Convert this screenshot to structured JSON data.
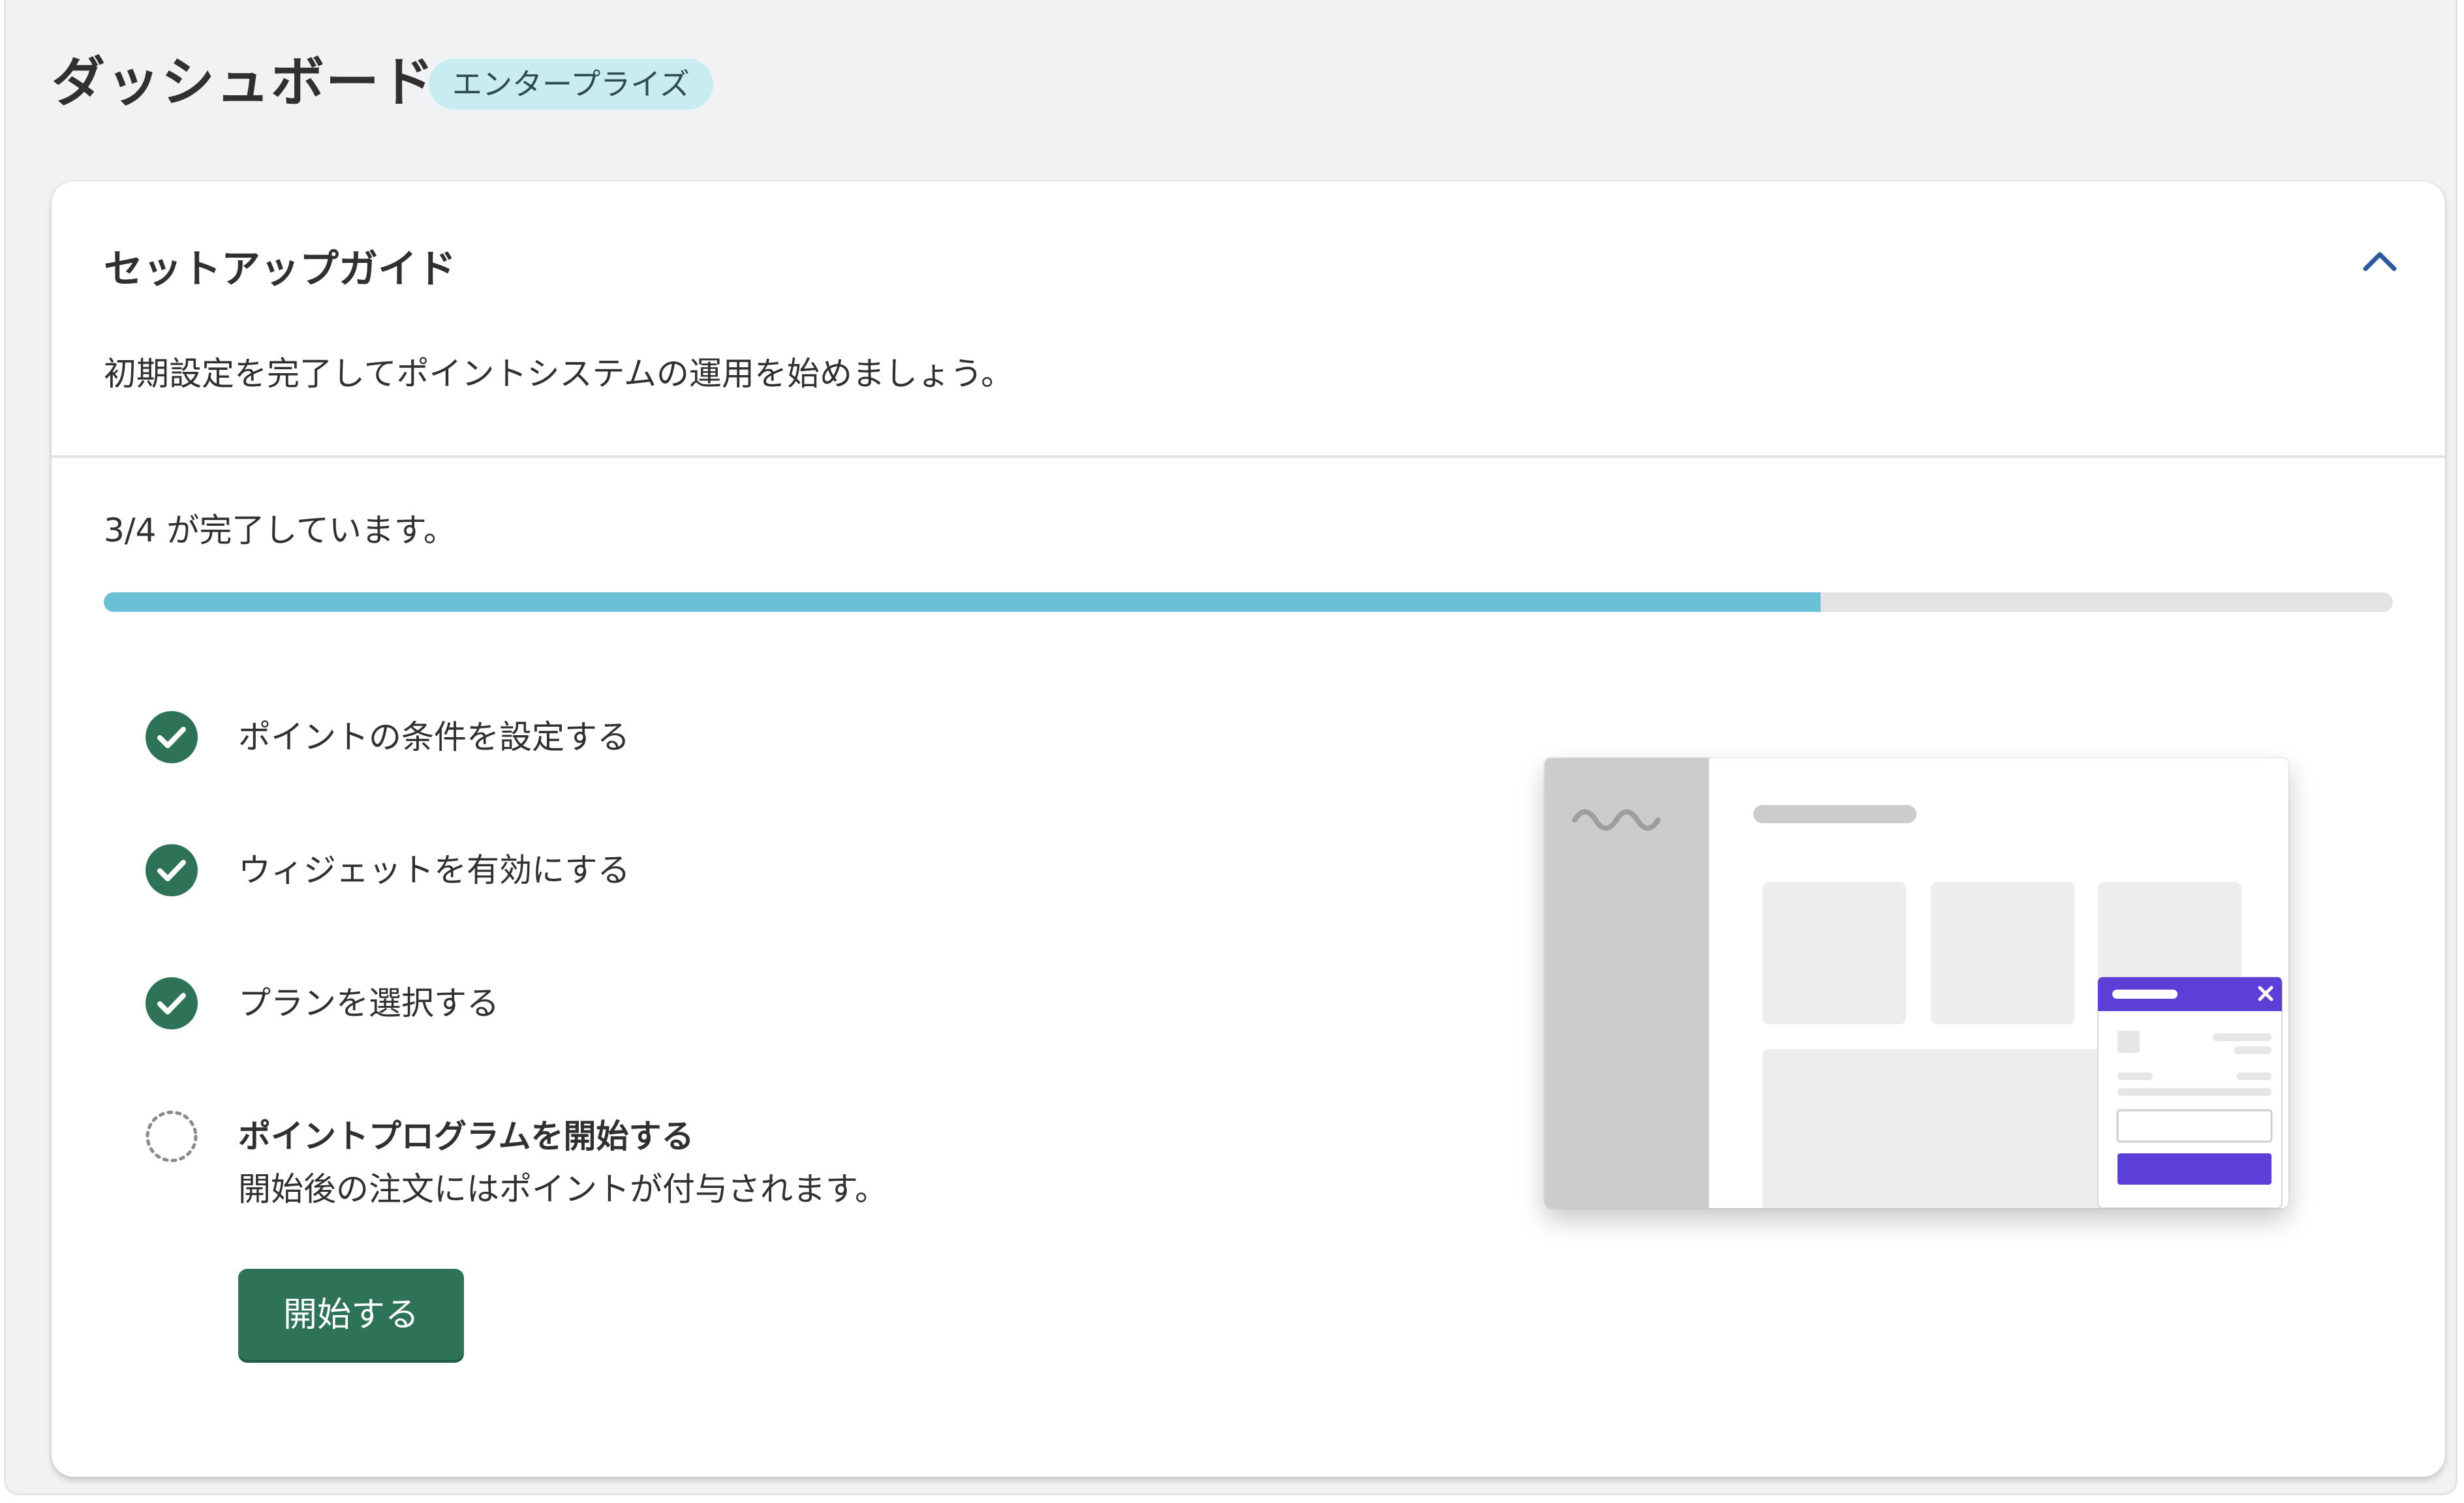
{
  "header": {
    "title": "ダッシュボード",
    "plan_badge": "エンタープライズ"
  },
  "setup_guide": {
    "title": "セットアップガイド",
    "description": "初期設定を完了してポイントシステムの運用を始めましょう。",
    "collapse_icon": "chevron-up-icon",
    "progress": {
      "label": "3/4 が完了しています。",
      "completed": 3,
      "total": 4
    },
    "tasks": [
      {
        "label": "ポイントの条件を設定する",
        "status": "complete"
      },
      {
        "label": "ウィジェットを有効にする",
        "status": "complete"
      },
      {
        "label": "プランを選択する",
        "status": "complete"
      },
      {
        "label": "ポイントプログラムを開始する",
        "status": "incomplete",
        "description": "開始後の注文にはポイントが付与されます。",
        "button_label": "開始する"
      }
    ]
  },
  "colors": {
    "accent_green": "#2e7358",
    "check_green": "#2e7358",
    "progress_fill": "#6ac0d4",
    "progress_track": "#e3e3e6",
    "badge_bg": "#c9ecf2",
    "widget_purple": "#5b3fd6",
    "collapse_icon_blue": "#2e5a9e"
  }
}
